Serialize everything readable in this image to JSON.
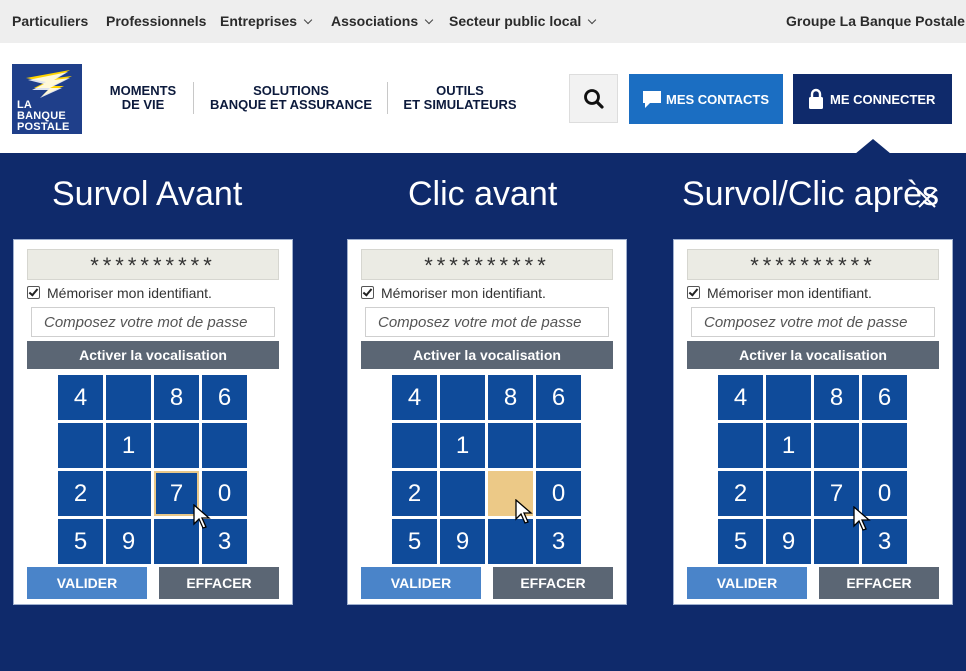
{
  "topbar": {
    "items": [
      "Particuliers",
      "Professionnels",
      "Entreprises",
      "Associations",
      "Secteur public local"
    ],
    "group": "Groupe La Banque Postale"
  },
  "logo": {
    "line1": "LA",
    "line2": "BANQUE",
    "line3": "POSTALE"
  },
  "nav": [
    {
      "line1": "MOMENTS",
      "line2": "DE VIE"
    },
    {
      "line1": "SOLUTIONS",
      "line2": "BANQUE ET ASSURANCE"
    },
    {
      "line1": "OUTILS",
      "line2": "ET SIMULATEURS"
    }
  ],
  "header": {
    "contacts_label": "MES CONTACTS",
    "connect_label": "ME CONNECTER"
  },
  "panels": [
    {
      "title": "Survol Avant",
      "masked_id": "**********",
      "remember_label": "Mémoriser mon identifiant.",
      "password_placeholder": "Composez votre mot de passe",
      "vocal_label": "Activer la vocalisation",
      "keys": [
        "4",
        "",
        "8",
        "6",
        "",
        "1",
        "",
        "",
        "2",
        "",
        "7",
        "0",
        "5",
        "9",
        "",
        "3"
      ],
      "state": "hover on key 7",
      "validate_label": "VALIDER",
      "clear_label": "EFFACER"
    },
    {
      "title": "Clic avant",
      "masked_id": "**********",
      "remember_label": "Mémoriser mon identifiant.",
      "password_placeholder": "Composez votre mot de passe",
      "vocal_label": "Activer la vocalisation",
      "keys": [
        "4",
        "",
        "8",
        "6",
        "",
        "1",
        "",
        "",
        "2",
        "",
        "",
        "0",
        "5",
        "9",
        "",
        "3"
      ],
      "state": "pressed key highlighted",
      "validate_label": "VALIDER",
      "clear_label": "EFFACER"
    },
    {
      "title": "Survol/Clic après",
      "masked_id": "**********",
      "remember_label": "Mémoriser mon identifiant.",
      "password_placeholder": "Composez votre mot de passe",
      "vocal_label": "Activer la vocalisation",
      "keys": [
        "4",
        "",
        "8",
        "6",
        "",
        "1",
        "",
        "",
        "2",
        "",
        "7",
        "0",
        "5",
        "9",
        "",
        "3"
      ],
      "state": "after click",
      "validate_label": "VALIDER",
      "clear_label": "EFFACER"
    }
  ],
  "colors": {
    "navy": "#0f2a6b",
    "key_blue": "#0f4b9a",
    "contacts_blue": "#1b6ec2",
    "highlight": "#ecc987",
    "gray_button": "#5b6674"
  },
  "icons": [
    "search-icon",
    "chat-icon",
    "lock-icon",
    "close-icon",
    "chevron-down-icon",
    "cursor-icon"
  ]
}
